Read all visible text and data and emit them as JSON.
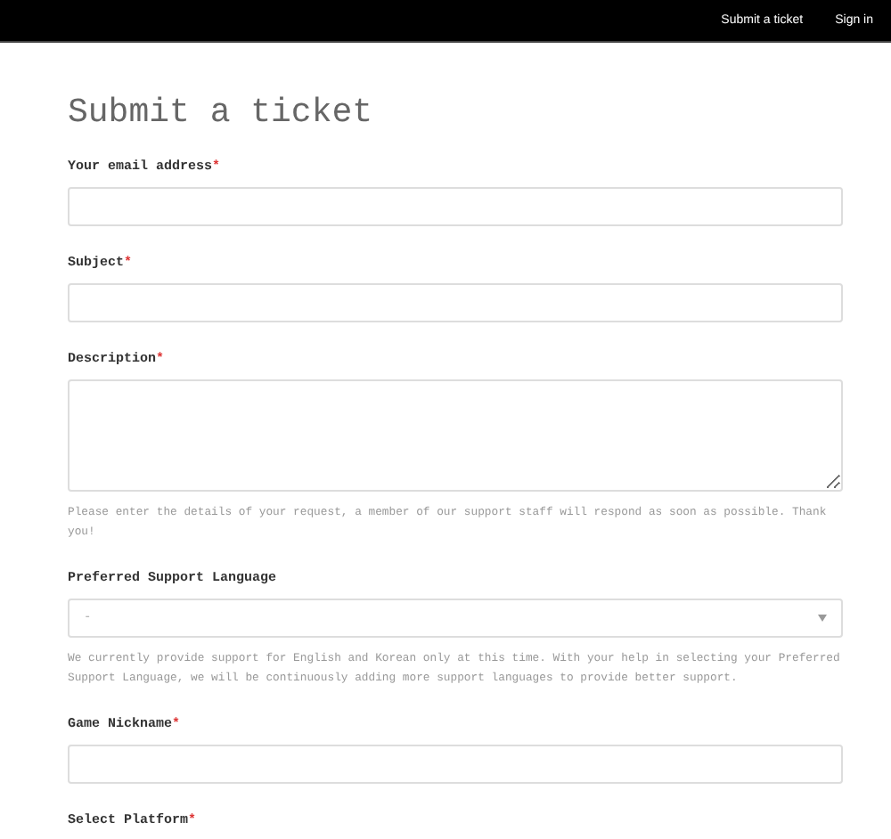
{
  "nav": {
    "links": [
      "Submit a ticket",
      "Sign in"
    ]
  },
  "title": "Submit a ticket",
  "fields": [
    {
      "kind": "input",
      "label": "Your email address",
      "mark": "*"
    },
    {
      "kind": "input",
      "label": "Subject",
      "mark": "*"
    },
    {
      "kind": "textarea",
      "label": "Description",
      "mark": "*",
      "hint": "Please enter the details of your request, a member of our support staff will respond as soon as possible. Thank you!"
    },
    {
      "kind": "select",
      "label": "Preferred Support Language",
      "value": "-",
      "hint": "We currently provide support for English and Korean only at this time. With your help in selecting your Preferred Support Language, we will be continuously adding more support languages to provide better support."
    },
    {
      "kind": "input",
      "label": "Game Nickname",
      "mark": "*"
    },
    {
      "kind": "label",
      "label": "Select Platform",
      "mark": "*"
    }
  ]
}
